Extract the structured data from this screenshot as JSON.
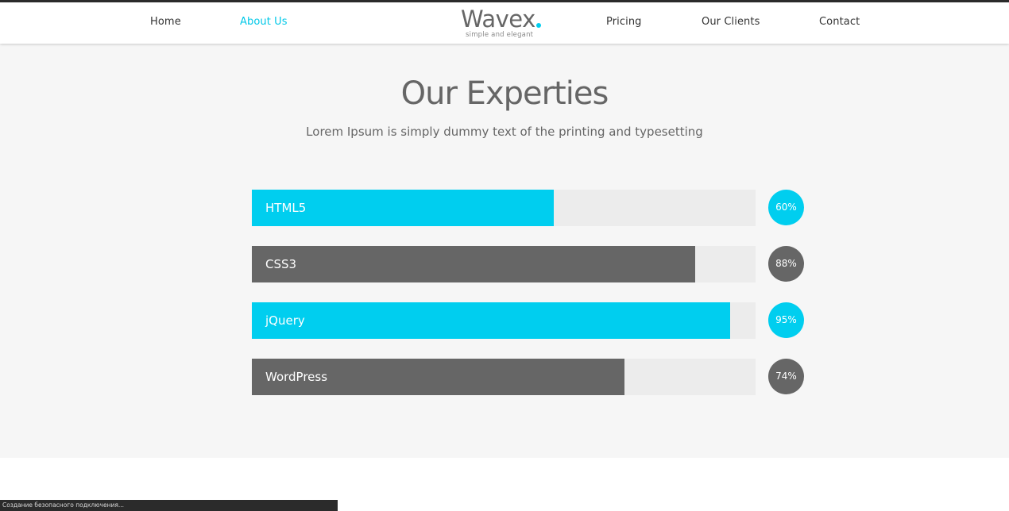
{
  "nav": {
    "left_links": [
      {
        "label": "Home",
        "active": false
      },
      {
        "label": "About  Us",
        "active": true
      }
    ],
    "right_links": [
      {
        "label": "Pricing",
        "active": false
      },
      {
        "label": "Our  Clients",
        "active": false
      },
      {
        "label": "Contact",
        "active": false
      }
    ]
  },
  "logo": {
    "word": "Wavex",
    "tagline": "simple and elegant"
  },
  "section": {
    "title": "Our Experties",
    "subtitle": "Lorem Ipsum is simply dummy text of the printing and typesetting"
  },
  "skills": [
    {
      "name": "HTML5",
      "percent_label": "60%",
      "fill_fraction": 0.6,
      "color": "#00ceef"
    },
    {
      "name": "CSS3",
      "percent_label": "88%",
      "fill_fraction": 0.88,
      "color": "#666666"
    },
    {
      "name": "jQuery",
      "percent_label": "95%",
      "fill_fraction": 0.95,
      "color": "#00ceef"
    },
    {
      "name": "WordPress",
      "percent_label": "74%",
      "fill_fraction": 0.74,
      "color": "#666666"
    }
  ],
  "status_bar": {
    "text": "Создание безопасного подключения..."
  },
  "colors": {
    "accent": "#00ceef",
    "dark": "#666666",
    "page_bg": "#f6f6f6"
  }
}
